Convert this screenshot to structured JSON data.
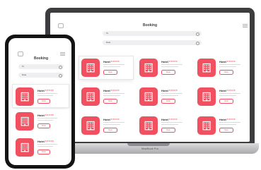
{
  "laptop": {
    "title": "Booking",
    "search_value": "To",
    "date_value": "Date",
    "brand": "MacBook Pro",
    "hotels": [
      {
        "name": "Hotel",
        "stars": "★★★★★",
        "button": "Book"
      },
      {
        "name": "Hotel",
        "stars": "★★★★★",
        "button": "Book"
      },
      {
        "name": "Hotel",
        "stars": "★★★★★",
        "button": "Book"
      },
      {
        "name": "Hotel",
        "stars": "★★★★★",
        "button": "Book"
      },
      {
        "name": "Hotel",
        "stars": "★★★★★",
        "button": "Book"
      },
      {
        "name": "Hotel",
        "stars": "★★★★★",
        "button": "Book"
      },
      {
        "name": "Hotel",
        "stars": "★★★★★",
        "button": "Book"
      },
      {
        "name": "Hotel",
        "stars": "★★★★★",
        "button": "Book"
      },
      {
        "name": "Hotel",
        "stars": "★★★★★",
        "button": "Book"
      }
    ]
  },
  "phone": {
    "title": "Booking",
    "search_value": "To",
    "date_value": "Date",
    "hotels": [
      {
        "name": "Hotel",
        "stars": "★★★★★",
        "button": "Book"
      },
      {
        "name": "Hotel",
        "stars": "★★★★★",
        "button": "Book"
      },
      {
        "name": "Hotel",
        "stars": "★★★★★",
        "button": "Book"
      }
    ]
  },
  "colors": {
    "accent": "#f0505f",
    "device_frame": "#3d3d3f",
    "phone_frame": "#141414"
  },
  "icons": [
    "home-icon",
    "menu-icon",
    "search-icon",
    "hotel-building-icon"
  ]
}
